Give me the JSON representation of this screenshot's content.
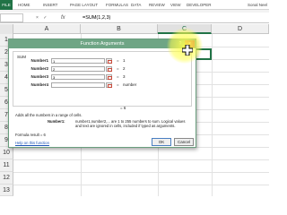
{
  "ribbon": {
    "file_tab": "FILE",
    "tabs": [
      "HOME",
      "INSERT",
      "PAGE LAYOUT",
      "FORMULAS",
      "DATA",
      "REVIEW",
      "VIEW",
      "DEVELOPER"
    ],
    "user_name": "Sonal Neel"
  },
  "formula_bar": {
    "fx": "fx",
    "separators": "× ✓",
    "formula": "=SUM(1,2,3)"
  },
  "grid": {
    "columns": [
      "A",
      "B",
      "C",
      "D"
    ],
    "active_column": "C",
    "rows": [
      "1",
      "2",
      "3",
      "4",
      "5",
      "6",
      "7",
      "8",
      "9",
      "10",
      "11",
      "12",
      "13"
    ]
  },
  "dialog": {
    "title": "Function Arguments",
    "help_button": "?",
    "close_button": "×",
    "function_name": "SUM",
    "arguments": [
      {
        "label": "Number1",
        "value": "1",
        "eq": "=",
        "result": "1"
      },
      {
        "label": "Number2",
        "value": "2",
        "eq": "=",
        "result": "2"
      },
      {
        "label": "Number3",
        "value": "3",
        "eq": "=",
        "result": "3"
      },
      {
        "label": "Number4",
        "value": "",
        "eq": "=",
        "result": "number"
      }
    ],
    "result_equation": "= 6",
    "description": "Adds all the numbers in a range of cells.",
    "arg_desc_label": "Number1:",
    "arg_desc": "number1,number2,... are 1 to 255 numbers to sum. Logical values and text are ignored in cells, included if typed as arguments.",
    "formula_result": "Formula result = 6",
    "help_link": "Help on this function",
    "ok_label": "OK",
    "cancel_label": "Cancel"
  },
  "colors": {
    "excel_green": "#217346",
    "dialog_title_bg": "#6fa585",
    "highlight": "#ffff50",
    "link": "#1f56b8"
  },
  "icons": [
    "fx-icon",
    "reference-picker-icon",
    "help-icon",
    "close-icon",
    "cursor-plus-icon"
  ]
}
